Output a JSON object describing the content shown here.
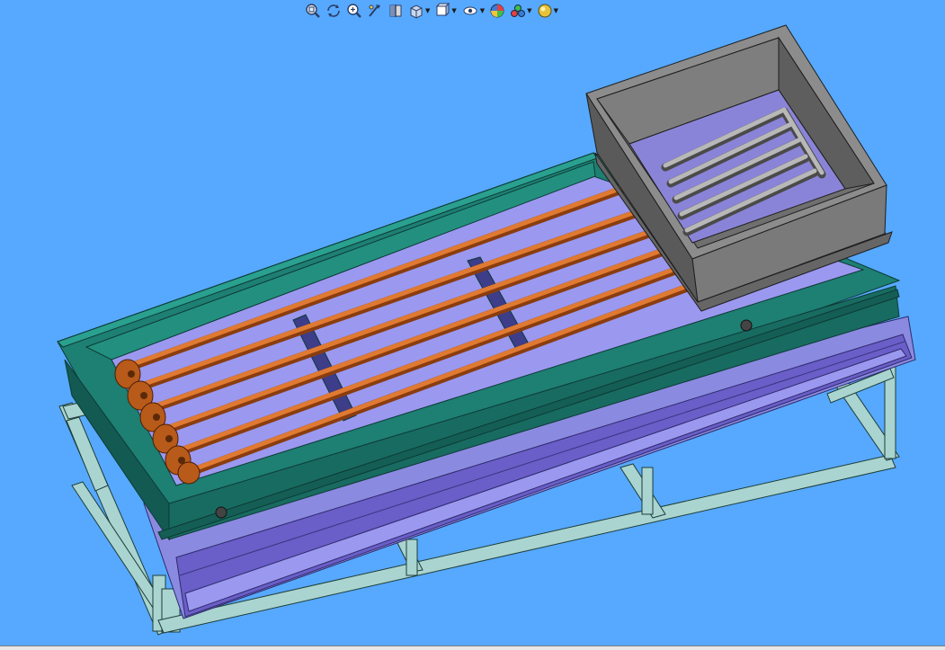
{
  "viewport": {
    "background": "#56a9ff"
  },
  "heads_up_toolbar": {
    "items": [
      {
        "name": "zoom-to-fit-icon"
      },
      {
        "name": "rotate-view-icon"
      },
      {
        "name": "zoom-to-area-icon"
      },
      {
        "name": "previous-view-icon"
      },
      {
        "name": "section-view-icon"
      },
      {
        "name": "view-orientation-icon",
        "has_dropdown": true
      },
      {
        "name": "display-style-icon",
        "has_dropdown": true
      },
      {
        "name": "hide-show-items-icon",
        "has_dropdown": true
      },
      {
        "name": "edit-appearance-icon"
      },
      {
        "name": "apply-scene-icon",
        "has_dropdown": true
      },
      {
        "name": "view-settings-icon",
        "has_dropdown": true
      }
    ]
  },
  "model": {
    "colors": {
      "frame": "#a9d4d0",
      "frame_edge": "#1f3d3a",
      "tray": "#8a8ae0",
      "tray_dark": "#6a5ec8",
      "tank": "#1e7f73",
      "tank_dark": "#135a52",
      "tank_floor": "#9b98f0",
      "pipe": "#c8651f",
      "pipe_light": "#e88a45",
      "hopper": "#7b7b7b",
      "hopper_dark": "#555555",
      "grate": "#a0a0a0"
    }
  }
}
